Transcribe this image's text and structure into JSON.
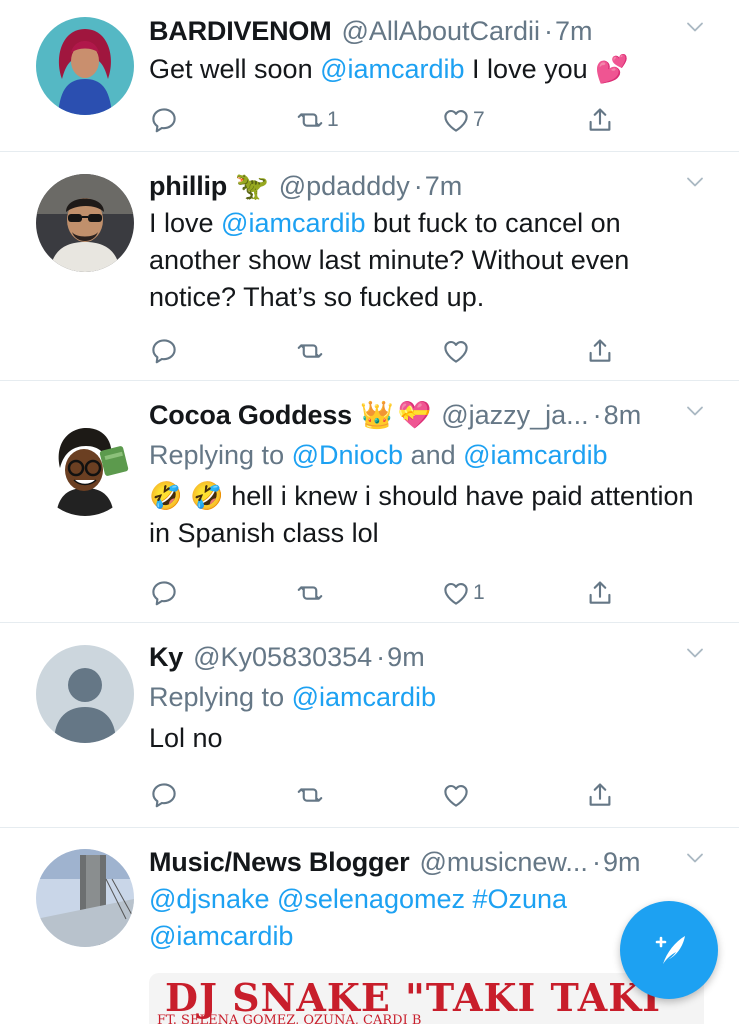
{
  "tweets": [
    {
      "name": "BARDIVENOM",
      "handle": "@AllAboutCardii",
      "time": "7m",
      "text_parts": [
        "Get well soon ",
        "@iamcardib",
        " I love you "
      ],
      "emoji": "💕",
      "reply_count": "",
      "retweet_count": "1",
      "like_count": "7"
    },
    {
      "name": "phillip",
      "emoji": "🦖",
      "handle": "@pdadddy",
      "time": "7m",
      "text_parts": [
        "I love ",
        "@iamcardib",
        " but fuck to cancel on another show last minute? Without even notice? That’s so fucked up."
      ],
      "retweet_count": "",
      "like_count": ""
    },
    {
      "name": "Cocoa Goddess",
      "emoji_1": "👑",
      "emoji_2": "💝",
      "handle": "@jazzy_ja...",
      "time": "8m",
      "replying_label": "Replying to ",
      "replying_to_1": "@Dniocb",
      "replying_and": " and ",
      "replying_to_2": "@iamcardib",
      "lead_emoji": "🤣 🤣",
      "text": " hell i knew i should have paid attention in Spanish class lol",
      "retweet_count": "",
      "like_count": "1"
    },
    {
      "name": "Ky",
      "handle": "@Ky05830354",
      "time": "9m",
      "replying_label": "Replying to ",
      "replying_to_1": "@iamcardib",
      "text": "Lol no",
      "retweet_count": "",
      "like_count": ""
    },
    {
      "name": "Music/News Blogger",
      "handle": "@musicnew...",
      "time": "9m",
      "mentions_line1": "@djsnake @selenagomez #Ozuna",
      "mentions_line2": "@iamcardib",
      "media_title": "DJ SNAKE \"TAKI TAKI",
      "media_sub": "FT. SELENA GOMEZ, OZUNA, CARDI B"
    }
  ],
  "dot": "·",
  "colors": {
    "accent": "#1da1f2",
    "secondary_text": "#657786",
    "divider": "#e6ecf0"
  },
  "icons": [
    "reply-icon",
    "retweet-icon",
    "like-icon",
    "share-icon",
    "chevron-down-icon",
    "compose-tweet-icon"
  ]
}
